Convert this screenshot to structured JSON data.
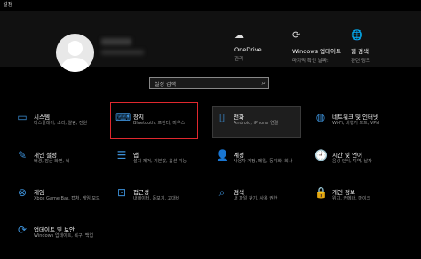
{
  "window": {
    "title": "설정"
  },
  "header": {
    "items": [
      {
        "icon": "cloud-icon",
        "title": "OneDrive",
        "sub": "관리"
      },
      {
        "icon": "update-icon",
        "title": "Windows 업데이트",
        "sub": "마지막 확인 날짜:"
      },
      {
        "icon": "globe-icon",
        "title": "웹 검색",
        "sub": "관련 링크"
      }
    ]
  },
  "search": {
    "placeholder": "설정 검색"
  },
  "tiles": [
    {
      "icon": "laptop-icon",
      "title": "시스템",
      "sub": "디스플레이, 소리, 알림, 전원"
    },
    {
      "icon": "keyboard-icon",
      "title": "장치",
      "sub": "Bluetooth, 프린터, 마우스"
    },
    {
      "icon": "phone-icon",
      "title": "전화",
      "sub": "Android, iPhone 연결"
    },
    {
      "icon": "globe-icon",
      "title": "네트워크 및 인터넷",
      "sub": "Wi-Fi, 비행기 모드, VPN"
    },
    {
      "icon": "brush-icon",
      "title": "개인 설정",
      "sub": "배경, 잠금 화면, 색"
    },
    {
      "icon": "apps-icon",
      "title": "앱",
      "sub": "설치 제거, 기본값, 옵션 기능"
    },
    {
      "icon": "person-icon",
      "title": "계정",
      "sub": "사용자 계정, 메일, 동기화, 회사"
    },
    {
      "icon": "time-icon",
      "title": "시간 및 언어",
      "sub": "음성 인식, 지역, 날짜"
    },
    {
      "icon": "xbox-icon",
      "title": "게임",
      "sub": "Xbox Game Bar, 캡처, 게임 모드"
    },
    {
      "icon": "accessibility-icon",
      "title": "접근성",
      "sub": "내레이터, 돋보기, 고대비"
    },
    {
      "icon": "search-icon",
      "title": "검색",
      "sub": "내 파일 찾기, 사용 권한"
    },
    {
      "icon": "lock-icon",
      "title": "개인 정보",
      "sub": "위치, 카메라, 마이크"
    },
    {
      "icon": "update-icon",
      "title": "업데이트 및 보안",
      "sub": "Windows 업데이트, 복구, 백업"
    }
  ]
}
